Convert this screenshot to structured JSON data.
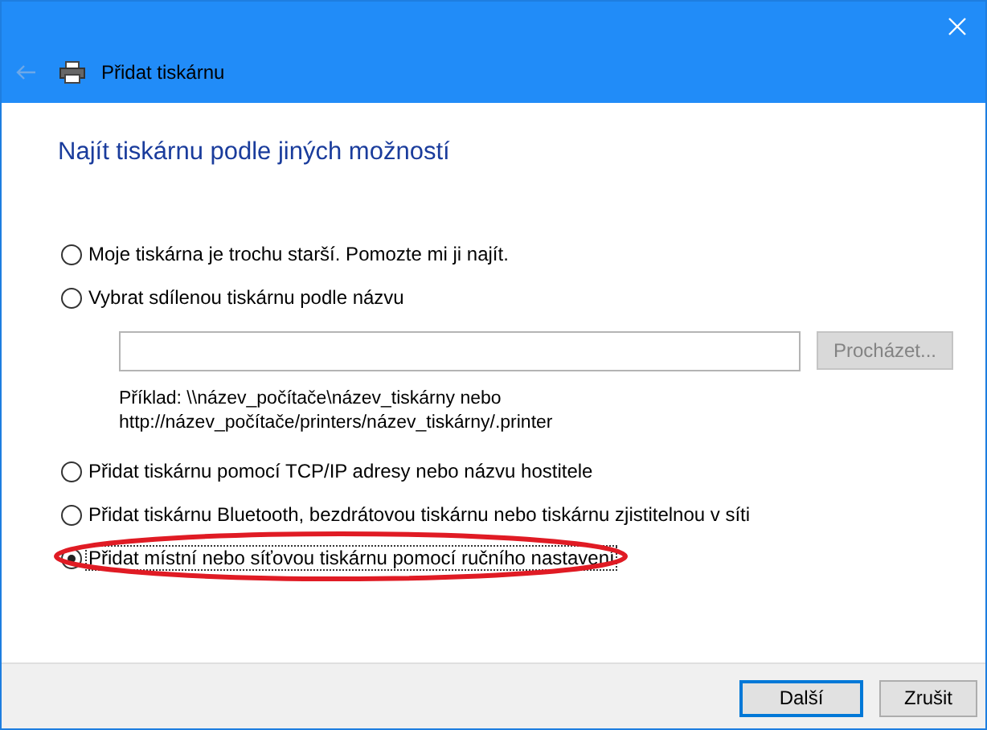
{
  "window": {
    "title": "Přidat tiskárnu"
  },
  "heading": "Najít tiskárnu podle jiných možností",
  "options": [
    {
      "label": "Moje tiskárna je trochu starší. Pomozte mi ji najít.",
      "selected": false
    },
    {
      "label": "Vybrat sdílenou tiskárnu podle názvu",
      "selected": false,
      "share": {
        "browse": "Procházet...",
        "browse_disabled": true,
        "example": [
          "Příklad: \\\\název_počítače\\název_tiskárny nebo",
          "http://název_počítače/printers/název_tiskárny/.printer"
        ]
      }
    },
    {
      "label": "Přidat tiskárnu pomocí TCP/IP adresy nebo názvu hostitele",
      "selected": false
    },
    {
      "label": "Přidat tiskárnu Bluetooth, bezdrátovou tiskárnu nebo tiskárnu zjistitelnou v síti",
      "selected": false
    },
    {
      "label": "Přidat místní nebo síťovou tiskárnu pomocí ručního nastavení",
      "selected": true,
      "highlighted": true
    }
  ],
  "buttons": [
    {
      "label": "Další",
      "default": true
    },
    {
      "label": "Zrušit",
      "default": false
    }
  ]
}
